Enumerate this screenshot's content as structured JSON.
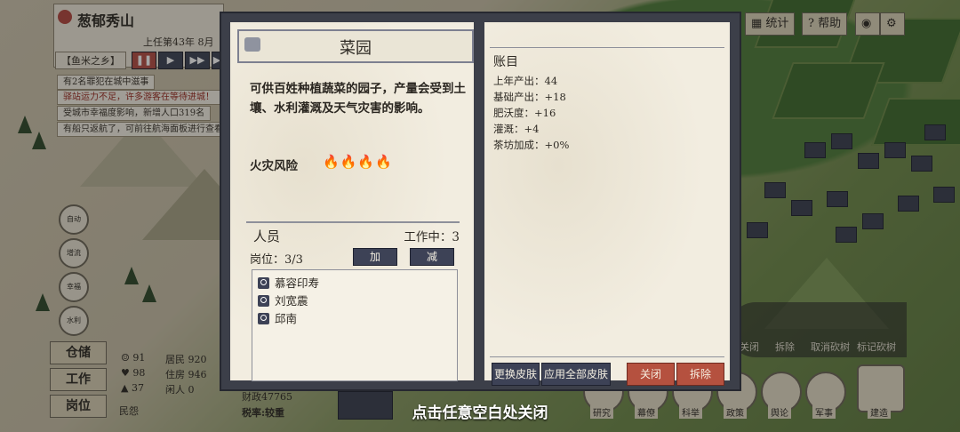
{
  "hud": {
    "city_name": "葱郁秀山",
    "tenure": "上任第43年 8月",
    "region": "【鱼米之乡】",
    "speed_buttons": [
      "❚❚",
      "▶",
      "▶▶",
      "▶"
    ],
    "notices": [
      {
        "text": "有2名罪犯在城中滋事",
        "alert": false
      },
      {
        "text": "驿站运力不足，许多游客在等待进城！",
        "alert": true
      },
      {
        "text": "受城市幸福度影响，新增人口319名",
        "alert": false
      },
      {
        "text": "有船只返航了，可前往航海面板进行查看",
        "alert": false
      }
    ],
    "side_buttons": [
      "自动",
      "增流",
      "幸福",
      "水利"
    ],
    "left_tabs": [
      "仓储",
      "工作",
      "岗位"
    ],
    "stats_left": [
      "91",
      "98",
      "37"
    ],
    "stats_right": [
      "居民 920",
      "住房 946",
      "闲人 0"
    ],
    "mood_label": "民怨",
    "finance": "财政47765",
    "tax": "税率:较重",
    "top_right": [
      "统计",
      "帮助"
    ],
    "tools": [
      "关闭",
      "拆除",
      "取消砍树",
      "标记砍树"
    ],
    "bottom_menu": [
      "研究",
      "幕僚",
      "科举",
      "政策",
      "舆论",
      "军事",
      "建造"
    ]
  },
  "modal": {
    "title": "菜园",
    "description": "可供百姓种植蔬菜的园子，产量会受到土壤、水利灌溉及天气灾害的影响。",
    "fire_label": "火灾风险",
    "fire_icons": "🔥🔥🔥🔥",
    "people_section": "人员",
    "working": "工作中：3",
    "posts": "岗位：3/3",
    "add_button": "加",
    "remove_button": "减",
    "people": [
      "慕容印寿",
      "刘宽震",
      "邱南"
    ],
    "ledger_title": "账目",
    "ledger": [
      "上年产出：44",
      "基础产出：+18",
      "肥沃度：+16",
      "灌溉：+4",
      "茶坊加成：+0%"
    ],
    "change_skin": "更换皮肤",
    "apply_all_skin": "应用全部皮肤",
    "close": "关闭",
    "demolish": "拆除"
  },
  "close_hint": "点击任意空白处关闭"
}
